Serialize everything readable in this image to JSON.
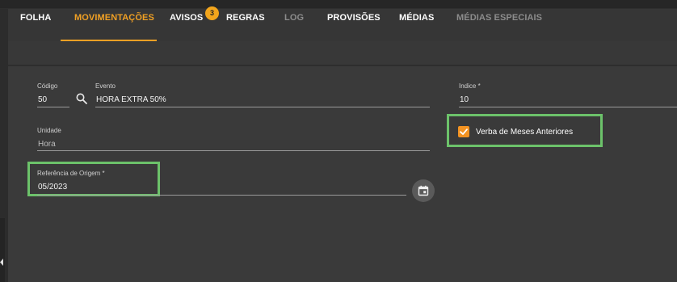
{
  "tabs": {
    "folha": "FOLHA",
    "movimentacoes": "MOVIMENTAÇÕES",
    "avisos": "AVISOS",
    "avisos_badge": "3",
    "regras": "REGRAS",
    "log": "LOG",
    "provisoes": "PROVISÕES",
    "medias": "MÉDIAS",
    "medias_especiais": "MÉDIAS ESPECIAIS",
    "active": "MOVIMENTAÇÕES"
  },
  "form": {
    "codigo": {
      "label": "Código",
      "value": "50"
    },
    "evento": {
      "label": "Evento",
      "value": "HORA EXTRA 50%"
    },
    "indice": {
      "label": "Indice *",
      "value": "10"
    },
    "unidade": {
      "label": "Unidade",
      "value": "Hora"
    },
    "verba_meses_anteriores": {
      "label": "Verba de Meses Anteriores",
      "checked": true
    },
    "referencia_origem": {
      "label": "Referência de Origem *",
      "value": "05/2023"
    }
  },
  "icons": {
    "search": "search-icon",
    "calendar": "calendar-icon",
    "check": "check-icon",
    "collapse": "chevron-left-icon"
  },
  "colors": {
    "accent": "#f0a024",
    "highlight": "#6cc26a",
    "checkbox": "#f39322"
  }
}
